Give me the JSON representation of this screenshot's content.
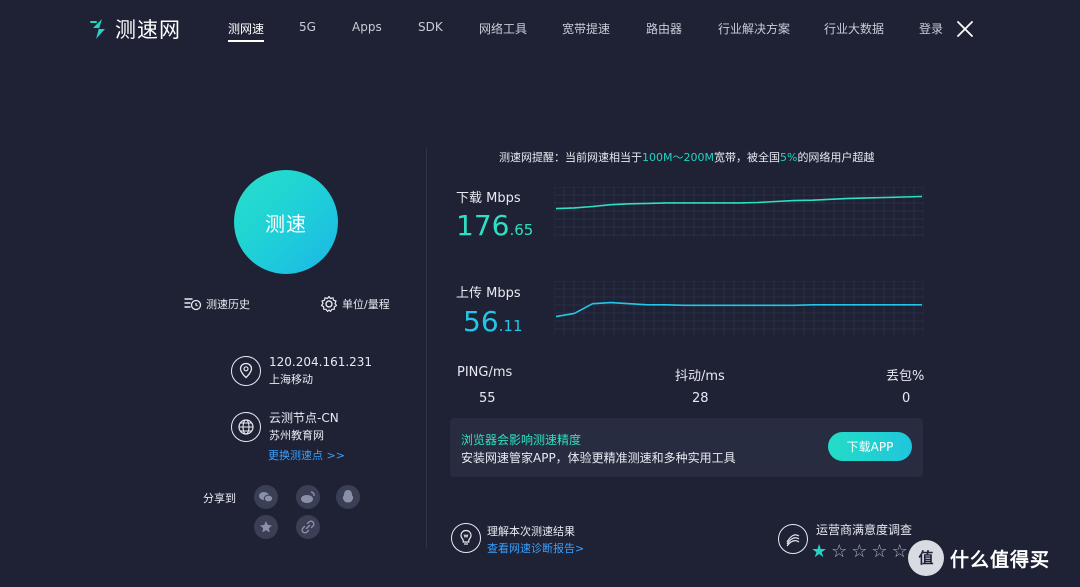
{
  "brand": {
    "logo_text": "测速网"
  },
  "nav": {
    "items": [
      {
        "label": "测网速"
      },
      {
        "label": "5G"
      },
      {
        "label": "Apps"
      },
      {
        "label": "SDK"
      },
      {
        "label": "网络工具"
      },
      {
        "label": "宽带提速"
      },
      {
        "label": "路由器"
      },
      {
        "label": "行业解决方案"
      },
      {
        "label": "行业大数据"
      },
      {
        "label": "登录"
      }
    ]
  },
  "left": {
    "speed_button": "测速",
    "history_label": "测速历史",
    "unit_label": "单位/量程",
    "ip": "120.204.161.231",
    "isp": "上海移动",
    "node_name": "云测节点-CN",
    "node_net": "苏州教育网",
    "change_node": "更换测速点 >>",
    "share_label": "分享到"
  },
  "tip": {
    "prefix": "测速网提醒：当前网速相当于",
    "range": "100M～200M",
    "middle": "宽带，被全国",
    "percent": "5%",
    "suffix": "的网络用户超越"
  },
  "download": {
    "label": "下载 Mbps",
    "value_int": "176",
    "value_dec": ".65"
  },
  "upload": {
    "label": "上传 Mbps",
    "value_int": "56",
    "value_dec": ".11"
  },
  "stats": {
    "ping_label": "PING/ms",
    "ping_value": "55",
    "jitter_label": "抖动/ms",
    "jitter_value": "28",
    "loss_label": "丢包%",
    "loss_value": "0"
  },
  "promo": {
    "title": "浏览器会影响测速精度",
    "subtitle": "安装网速管家APP，体验更精准测速和多种实用工具",
    "button": "下载APP"
  },
  "footer": {
    "understand_title": "理解本次测速结果",
    "understand_link": "查看网速诊断报告>",
    "survey_title": "运营商满意度调查",
    "rating": 1,
    "rating_max": 5
  },
  "watermark": {
    "text": "什么值得买"
  },
  "chart_data": [
    {
      "type": "line",
      "title": "下载 Mbps",
      "x": [
        0,
        1,
        2,
        3,
        4,
        5,
        6,
        7,
        8,
        9,
        10,
        11,
        12,
        13,
        14,
        15,
        16,
        17,
        18,
        19,
        20
      ],
      "series": [
        {
          "name": "下载 Mbps",
          "values": [
            125,
            128,
            134,
            142,
            146,
            148,
            150,
            150,
            150,
            150,
            150,
            152,
            156,
            160,
            162,
            166,
            170,
            172,
            174,
            176,
            178
          ]
        }
      ],
      "ylim": [
        0,
        220
      ],
      "color": "#2ee0c3",
      "grid": true
    },
    {
      "type": "line",
      "title": "上传 Mbps",
      "x": [
        0,
        1,
        2,
        3,
        4,
        5,
        6,
        7,
        8,
        9,
        10,
        11,
        12,
        13,
        14,
        15,
        16,
        17,
        18,
        19,
        20
      ],
      "series": [
        {
          "name": "上传 Mbps",
          "values": [
            34,
            40,
            58,
            60,
            58,
            56,
            56,
            55,
            55,
            55,
            55,
            55,
            55,
            55,
            56,
            56,
            56,
            56,
            56,
            56,
            56
          ]
        }
      ],
      "ylim": [
        0,
        100
      ],
      "color": "#23c6e8",
      "grid": true
    }
  ]
}
